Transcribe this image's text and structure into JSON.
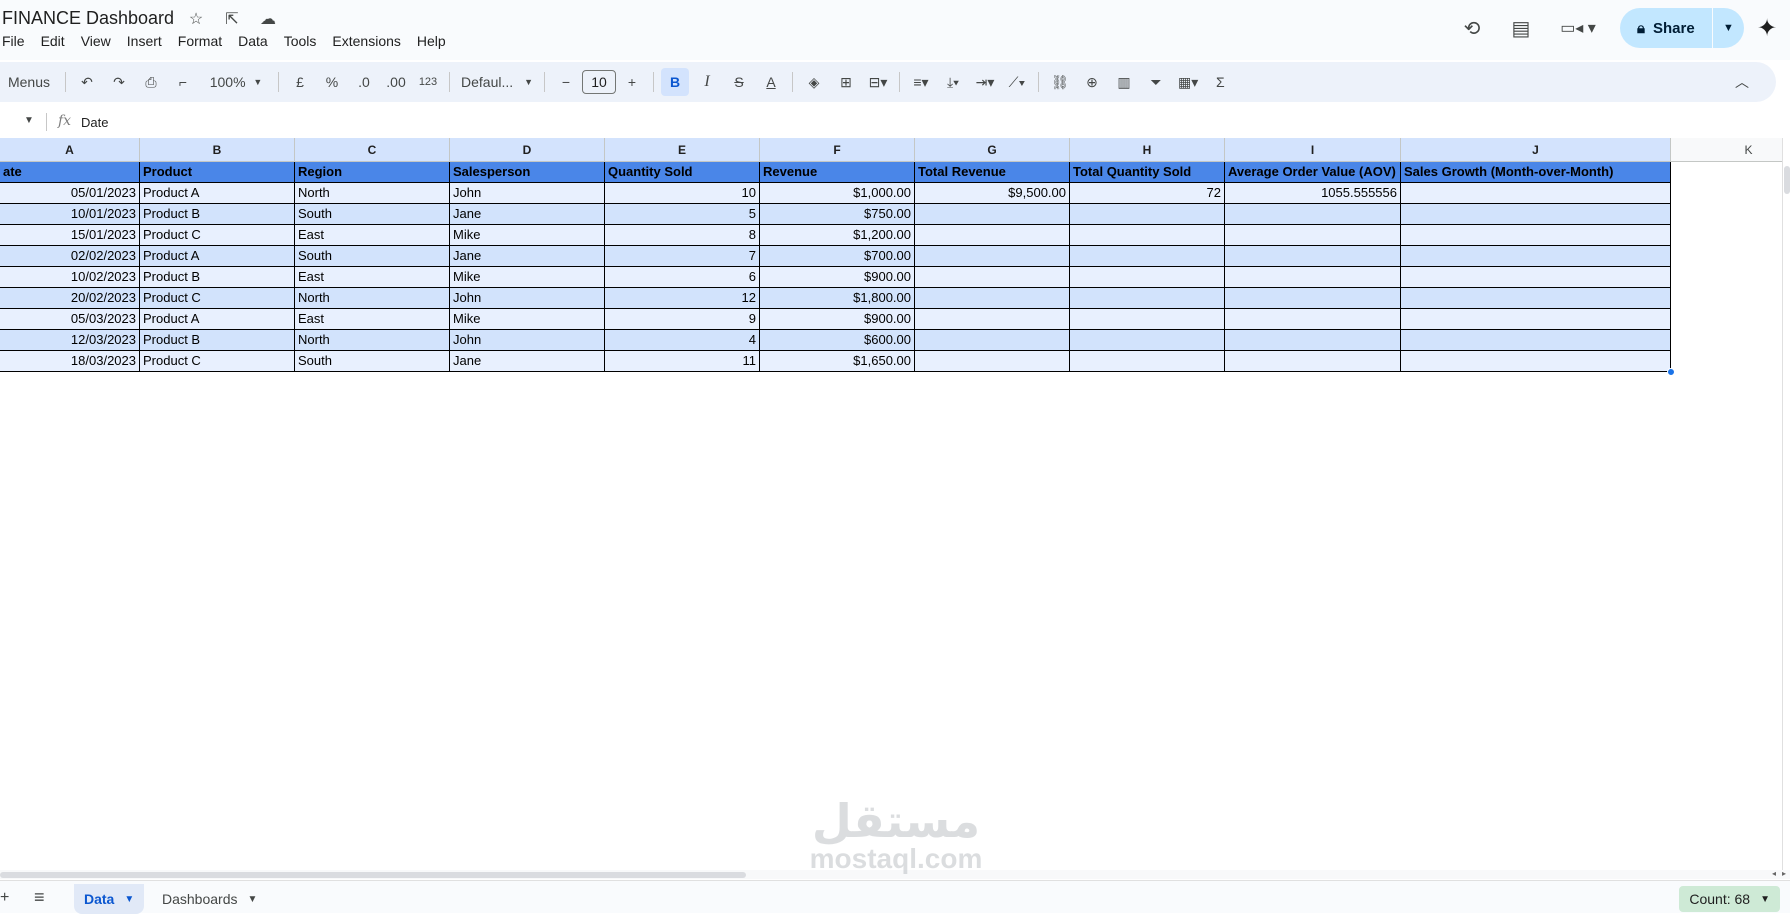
{
  "app": {
    "title": "FINANCE Dashboard",
    "title_icons": [
      "star-icon",
      "move-folder-icon",
      "cloud-saved-icon"
    ],
    "menu": [
      "File",
      "Edit",
      "View",
      "Insert",
      "Format",
      "Data",
      "Tools",
      "Extensions",
      "Help"
    ],
    "share_label": "Share",
    "right_icons": [
      "version-history-icon",
      "comments-icon",
      "meet-icon",
      "gemini-icon"
    ]
  },
  "toolbar": {
    "menus_search": "Menus",
    "zoom": "100%",
    "currency": "£",
    "percent": "%",
    "decrease_decimal": ".0",
    "increase_decimal": ".00",
    "number_format": "123",
    "font": "Defaul...",
    "font_size": "10",
    "bold": "B",
    "italic": "I",
    "strike": "S",
    "text_color": "A",
    "functions": "Σ"
  },
  "formula_bar": {
    "fx": "fx",
    "value": "Date"
  },
  "columns": [
    "A",
    "B",
    "C",
    "D",
    "E",
    "F",
    "G",
    "H",
    "I",
    "J",
    "K"
  ],
  "header_row": [
    "ate",
    "Product",
    "Region",
    "Salesperson",
    "Quantity Sold",
    "Revenue",
    "Total Revenue",
    "Total Quantity Sold",
    "Average Order Value (AOV)",
    "Sales Growth (Month-over-Month)"
  ],
  "rows": [
    [
      "05/01/2023",
      "Product A",
      "North",
      "John",
      "10",
      "$1,000.00",
      "$9,500.00",
      "72",
      "1055.555556",
      ""
    ],
    [
      "10/01/2023",
      "Product B",
      "South",
      "Jane",
      "5",
      "$750.00",
      "",
      "",
      "",
      ""
    ],
    [
      "15/01/2023",
      "Product C",
      "East",
      "Mike",
      "8",
      "$1,200.00",
      "",
      "",
      "",
      ""
    ],
    [
      "02/02/2023",
      "Product A",
      "South",
      "Jane",
      "7",
      "$700.00",
      "",
      "",
      "",
      ""
    ],
    [
      "10/02/2023",
      "Product B",
      "East",
      "Mike",
      "6",
      "$900.00",
      "",
      "",
      "",
      ""
    ],
    [
      "20/02/2023",
      "Product C",
      "North",
      "John",
      "12",
      "$1,800.00",
      "",
      "",
      "",
      ""
    ],
    [
      "05/03/2023",
      "Product A",
      "East",
      "Mike",
      "9",
      "$900.00",
      "",
      "",
      "",
      ""
    ],
    [
      "12/03/2023",
      "Product B",
      "North",
      "John",
      "4",
      "$600.00",
      "",
      "",
      "",
      ""
    ],
    [
      "18/03/2023",
      "Product C",
      "South",
      "Jane",
      "11",
      "$1,650.00",
      "",
      "",
      "",
      ""
    ]
  ],
  "sheets": {
    "tabs": [
      "Data",
      "Dashboards"
    ],
    "active": "Data",
    "count": "Count: 68"
  },
  "watermark": {
    "arabic": "مستقل",
    "latin": "mostaql.com"
  },
  "colors": {
    "header_fill": "#4a86e8",
    "row_light": "#e8f0fe",
    "row_dark": "#d2e3fc",
    "share": "#c2e7ff",
    "count_badge": "#ceead6"
  }
}
